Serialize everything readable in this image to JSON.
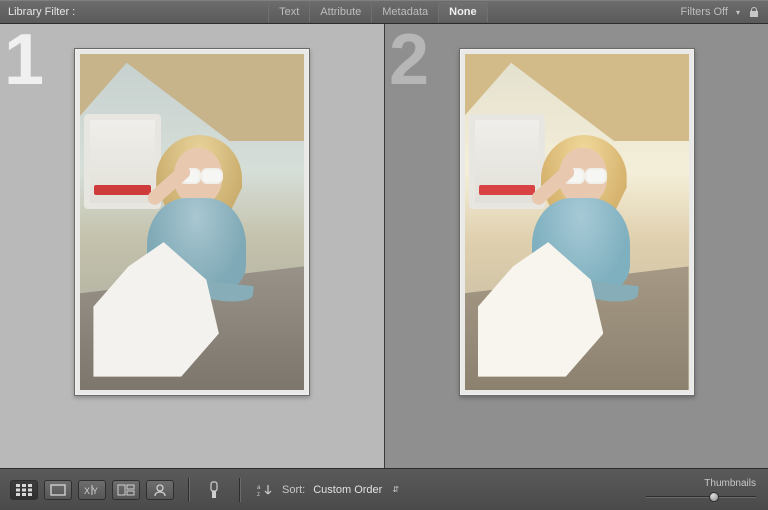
{
  "filter_bar": {
    "label": "Library Filter :",
    "tabs": [
      {
        "label": "Text",
        "selected": false
      },
      {
        "label": "Attribute",
        "selected": false
      },
      {
        "label": "Metadata",
        "selected": false
      },
      {
        "label": "None",
        "selected": true
      }
    ],
    "filters_off_label": "Filters Off"
  },
  "compare": {
    "left_index": "1",
    "right_index": "2"
  },
  "toolbar": {
    "sort_label": "Sort:",
    "sort_value": "Custom Order",
    "thumbnails_label": "Thumbnails",
    "thumbnails_slider_percent": 62
  }
}
